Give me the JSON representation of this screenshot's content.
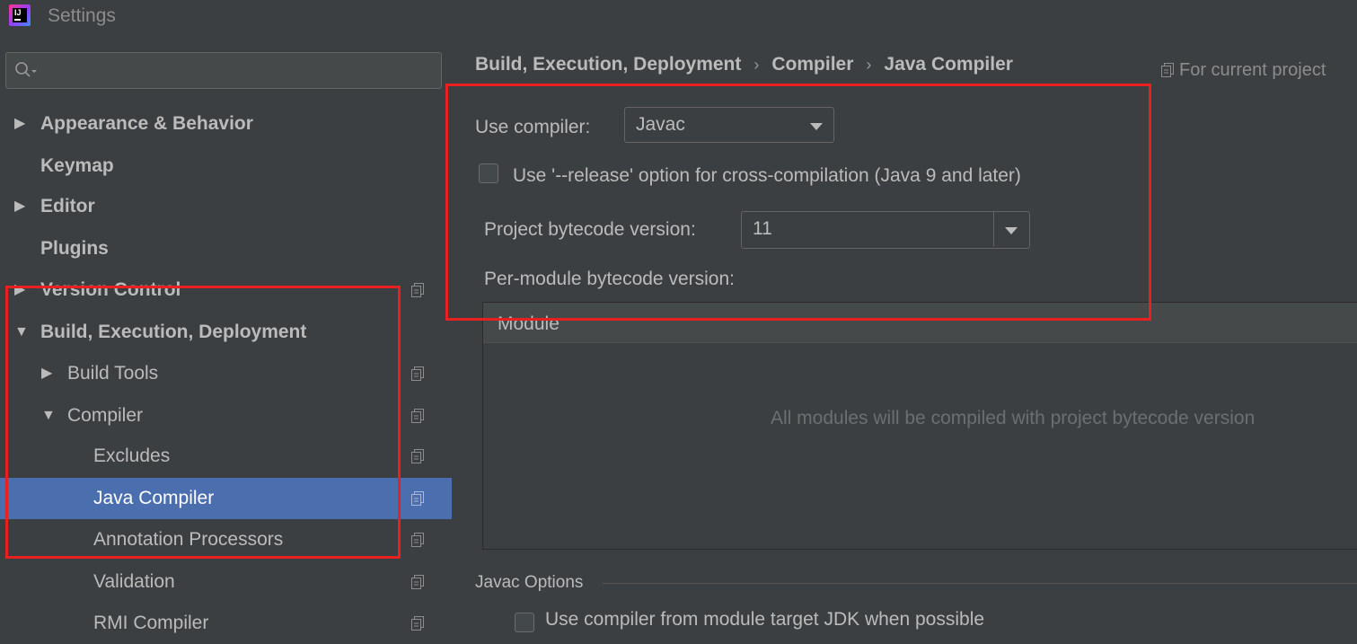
{
  "window": {
    "title": "Settings",
    "logo_text": "IJ"
  },
  "search": {
    "placeholder": "",
    "value": ""
  },
  "sidebar": {
    "items": [
      {
        "label": "Appearance & Behavior",
        "arrow": "▶"
      },
      {
        "label": "Keymap"
      },
      {
        "label": "Editor",
        "arrow": "▶"
      },
      {
        "label": "Plugins"
      },
      {
        "label": "Version Control",
        "arrow": "▶"
      },
      {
        "label": "Build, Execution, Deployment",
        "arrow": "▼"
      },
      {
        "label": "Build Tools",
        "arrow": "▶"
      },
      {
        "label": "Compiler",
        "arrow": "▼"
      },
      {
        "label": "Excludes"
      },
      {
        "label": "Java Compiler"
      },
      {
        "label": "Annotation Processors"
      },
      {
        "label": "Validation"
      },
      {
        "label": "RMI Compiler"
      }
    ]
  },
  "breadcrumb": {
    "items": [
      "Build, Execution, Deployment",
      "Compiler",
      "Java Compiler"
    ],
    "separator": "›"
  },
  "scope_label": "For current project",
  "compiler": {
    "use_compiler_label": "Use compiler:",
    "use_compiler_value": "Javac",
    "release_option_label": "Use '--release' option for cross-compilation (Java 9 and later)",
    "release_option_checked": false,
    "bytecode_label": "Project bytecode version:",
    "bytecode_value": "11",
    "per_module_label": "Per-module bytecode version:",
    "module_column": "Module",
    "empty_text": "All modules will be compiled with project bytecode version"
  },
  "javac_options": {
    "title": "Javac Options",
    "first_option_label": "Use compiler from module target JDK when possible"
  },
  "colors": {
    "background": "#3c3f41",
    "selection": "#4b6eaf",
    "annotation": "#e8201f"
  },
  "icons": [
    "search-icon",
    "copy-settings-icon",
    "dropdown-caret-icon",
    "tree-arrow-icon"
  ]
}
